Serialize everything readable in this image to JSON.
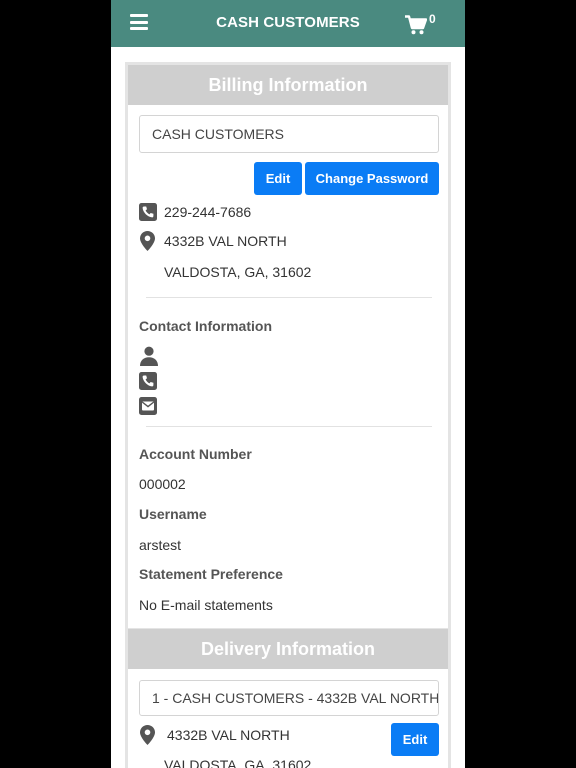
{
  "header": {
    "title": "CASH CUSTOMERS",
    "cart_count": "0",
    "menu_icon": "hamburger-menu-icon",
    "cart_icon": "shopping-cart-icon"
  },
  "billing": {
    "title": "Billing Information",
    "customer_name": "CASH CUSTOMERS",
    "edit_label": "Edit",
    "change_password_label": "Change Password",
    "phone": "229-244-7686",
    "address_line1": "4332B VAL NORTH",
    "address_line2": "VALDOSTA, GA, 31602"
  },
  "contact": {
    "title": "Contact Information",
    "icons": [
      "person-icon",
      "phone-icon",
      "envelope-icon"
    ]
  },
  "account": {
    "account_number_label": "Account Number",
    "account_number": "000002",
    "username_label": "Username",
    "username": "arstest",
    "statement_pref_label": "Statement Preference",
    "statement_pref": "No E-mail statements"
  },
  "delivery": {
    "title": "Delivery Information",
    "selected_address": "1 - CASH CUSTOMERS - 4332B VAL NORTH",
    "address_line1": "4332B VAL NORTH",
    "address_line2": "VALDOSTA, GA, 31602",
    "edit_label": "Edit"
  },
  "colors": {
    "header_bg": "#4a8a80",
    "panel_header_bg": "#cfcfcf",
    "button_blue": "#0a7cf5"
  }
}
